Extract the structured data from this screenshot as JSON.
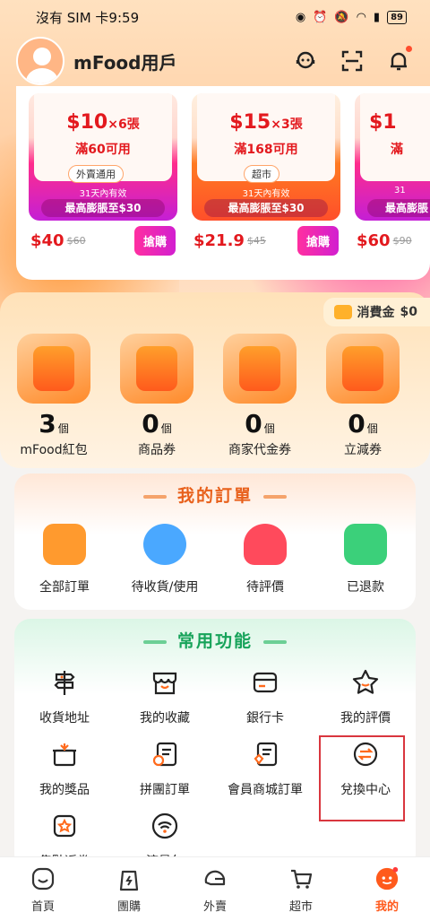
{
  "status": {
    "left": "沒有 SIM 卡9:59",
    "battery": "89"
  },
  "header": {
    "username": "mFood用戶"
  },
  "coupons": [
    {
      "amount": "$10",
      "count": "×6張",
      "condition": "滿60可用",
      "tag": "外賣通用",
      "validity": "31天內有效",
      "max": "最高膨脹至$30",
      "price": "$40",
      "orig": "$60",
      "buy": "搶購",
      "theme": "pink"
    },
    {
      "amount": "$15",
      "count": "×3張",
      "condition": "滿168可用",
      "tag": "超市",
      "validity": "31天內有效",
      "max": "最高膨脹至$30",
      "price": "$21.9",
      "orig": "$45",
      "buy": "搶購",
      "theme": "orange"
    },
    {
      "amount": "$1",
      "count": "",
      "condition": "滿",
      "tag": "",
      "validity": "31",
      "max": "最高膨脹",
      "price": "$60",
      "orig": "$90",
      "buy": "",
      "theme": "pink"
    }
  ],
  "wallet": {
    "spend_label": "消費金",
    "spend_value": "$0",
    "items": [
      {
        "count": "3",
        "unit": "個",
        "label": "mFood紅包"
      },
      {
        "count": "0",
        "unit": "個",
        "label": "商品券"
      },
      {
        "count": "0",
        "unit": "個",
        "label": "商家代金券"
      },
      {
        "count": "0",
        "unit": "個",
        "label": "立減券"
      }
    ]
  },
  "orders": {
    "title": "我的訂單",
    "items": [
      {
        "label": "全部訂單",
        "color": "#ff9a2e"
      },
      {
        "label": "待收貨/使用",
        "color": "#4aa8ff"
      },
      {
        "label": "待評價",
        "color": "#ff4a5c"
      },
      {
        "label": "已退款",
        "color": "#3bd07a"
      }
    ]
  },
  "funcs": {
    "title": "常用功能",
    "items": [
      {
        "label": "收貨地址",
        "icon": "signpost-icon"
      },
      {
        "label": "我的收藏",
        "icon": "shop-icon"
      },
      {
        "label": "銀行卡",
        "icon": "card-icon"
      },
      {
        "label": "我的評價",
        "icon": "star-icon"
      },
      {
        "label": "我的獎品",
        "icon": "gift-icon"
      },
      {
        "label": "拼團訂單",
        "icon": "group-order-icon"
      },
      {
        "label": "會員商城訂單",
        "icon": "member-order-icon"
      },
      {
        "label": "兌換中心",
        "icon": "exchange-icon"
      },
      {
        "label": "集點返券",
        "icon": "points-icon"
      },
      {
        "label": "流量包",
        "icon": "wifi-icon"
      }
    ]
  },
  "tabs": [
    {
      "label": "首頁"
    },
    {
      "label": "團購"
    },
    {
      "label": "外賣"
    },
    {
      "label": "超市"
    },
    {
      "label": "我的"
    }
  ],
  "colors": {
    "accent": "#ff5a1c",
    "highlight": "#d9363e"
  }
}
